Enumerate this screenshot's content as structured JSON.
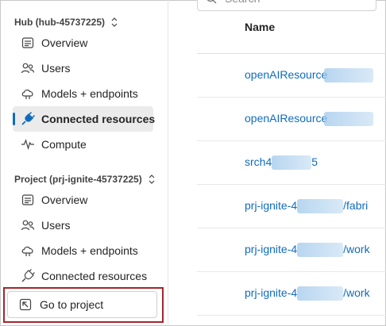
{
  "sidebar": {
    "hub_section": {
      "title": "Hub (hub-45737225)",
      "items": [
        {
          "label": "Overview",
          "icon": "overview-icon"
        },
        {
          "label": "Users",
          "icon": "users-icon"
        },
        {
          "label": "Models + endpoints",
          "icon": "cloud-models-icon"
        },
        {
          "label": "Connected resources",
          "icon": "plug-icon",
          "selected": true
        },
        {
          "label": "Compute",
          "icon": "pulse-icon"
        }
      ]
    },
    "project_section": {
      "title": "Project (prj-ignite-45737225)",
      "items": [
        {
          "label": "Overview",
          "icon": "overview-icon"
        },
        {
          "label": "Users",
          "icon": "users-icon"
        },
        {
          "label": "Models + endpoints",
          "icon": "cloud-models-icon"
        },
        {
          "label": "Connected resources",
          "icon": "plug-icon"
        }
      ]
    },
    "goto_button": {
      "label": "Go to project",
      "icon": "open-arrow-icon"
    }
  },
  "main": {
    "search_placeholder": "Search",
    "table": {
      "column_header": "Name",
      "rows": [
        {
          "prefix": "openAIResource",
          "suffix": ""
        },
        {
          "prefix": "openAIResource",
          "suffix": ""
        },
        {
          "prefix": "srch4",
          "suffix": "5"
        },
        {
          "prefix": "prj-ignite-4",
          "suffix": "/fabri"
        },
        {
          "prefix": "prj-ignite-4",
          "suffix": "/work"
        },
        {
          "prefix": "prj-ignite-4",
          "suffix": "/work"
        }
      ]
    }
  },
  "colors": {
    "accent": "#0f6cbd",
    "highlight_border": "#a4262c",
    "selected_bg": "#ebebeb"
  }
}
